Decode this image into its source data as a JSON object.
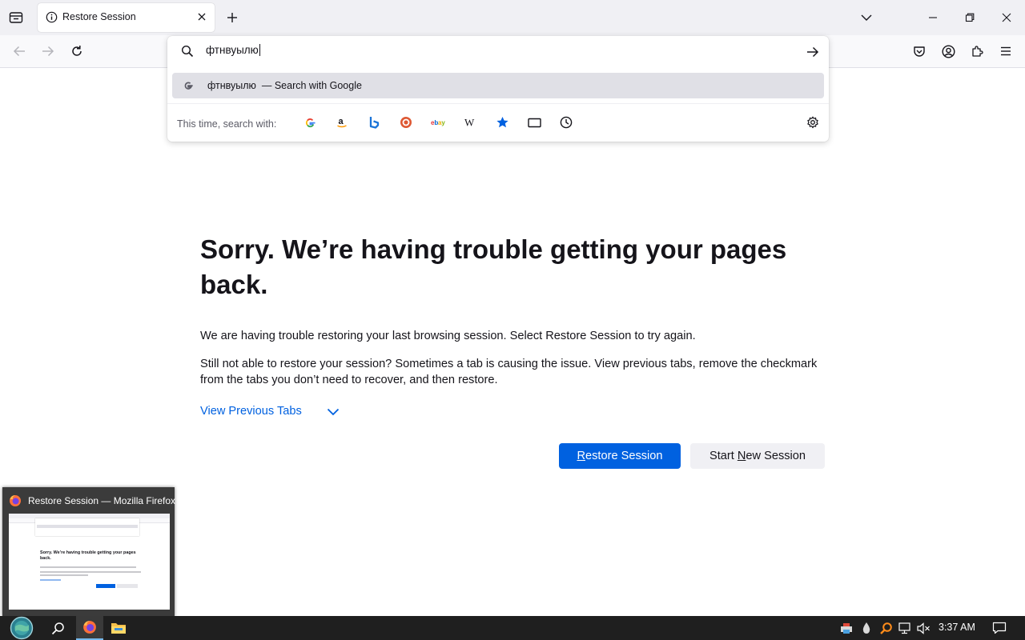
{
  "browser": {
    "tab": {
      "title": "Restore Session"
    },
    "url_panel": {
      "query": "фтнвуылю",
      "suggestion_query": "фтнвуылю",
      "suggestion_suffix": "— Search with Google",
      "one_off_label": "This time, search with:",
      "engines": [
        {
          "name": "google-icon"
        },
        {
          "name": "amazon-icon"
        },
        {
          "name": "bing-icon"
        },
        {
          "name": "duckduckgo-icon"
        },
        {
          "name": "ebay-icon"
        },
        {
          "name": "wikipedia-icon"
        },
        {
          "name": "bookmarks-icon"
        },
        {
          "name": "tabs-icon"
        },
        {
          "name": "history-icon"
        }
      ]
    }
  },
  "content": {
    "heading": "Sorry. We’re having trouble getting your pages back.",
    "para1": "We are having trouble restoring your last browsing session. Select Restore Session to try again.",
    "para2": "Still not able to restore your session? Sometimes a tab is causing the issue. View previous tabs, remove the checkmark from the tabs you don’t need to recover, and then restore.",
    "view_previous_tabs": "View Previous Tabs",
    "restore_button": {
      "accel": "R",
      "rest": "estore Session"
    },
    "new_session_button": {
      "before": "Start ",
      "accel": "N",
      "after": "ew Session"
    }
  },
  "preview": {
    "title": "Restore Session — Mozilla Firefox",
    "thumb_heading": "Sorry. We’re having trouble getting your pages back."
  },
  "taskbar": {
    "clock": "3:37 AM"
  },
  "colors": {
    "accent": "#0061e0",
    "tabstrip": "#f0f0f4",
    "taskbar": "#1f1f1f"
  }
}
